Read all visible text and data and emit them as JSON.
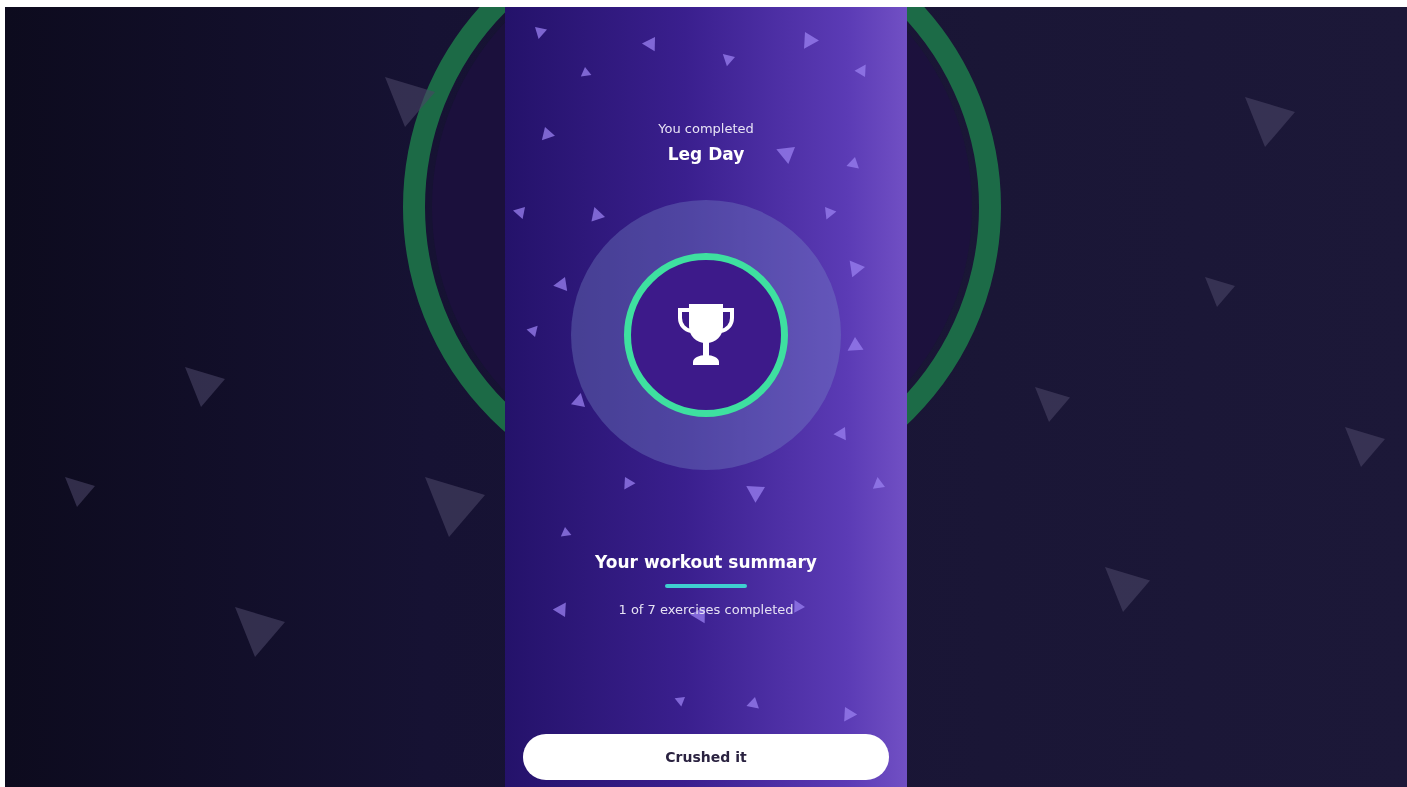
{
  "header": {
    "subtitle": "You completed",
    "title": "Leg Day"
  },
  "summary": {
    "title": "Your workout summary",
    "progress": "1 of 7 exercises completed"
  },
  "button": {
    "label": "Crushed it"
  }
}
